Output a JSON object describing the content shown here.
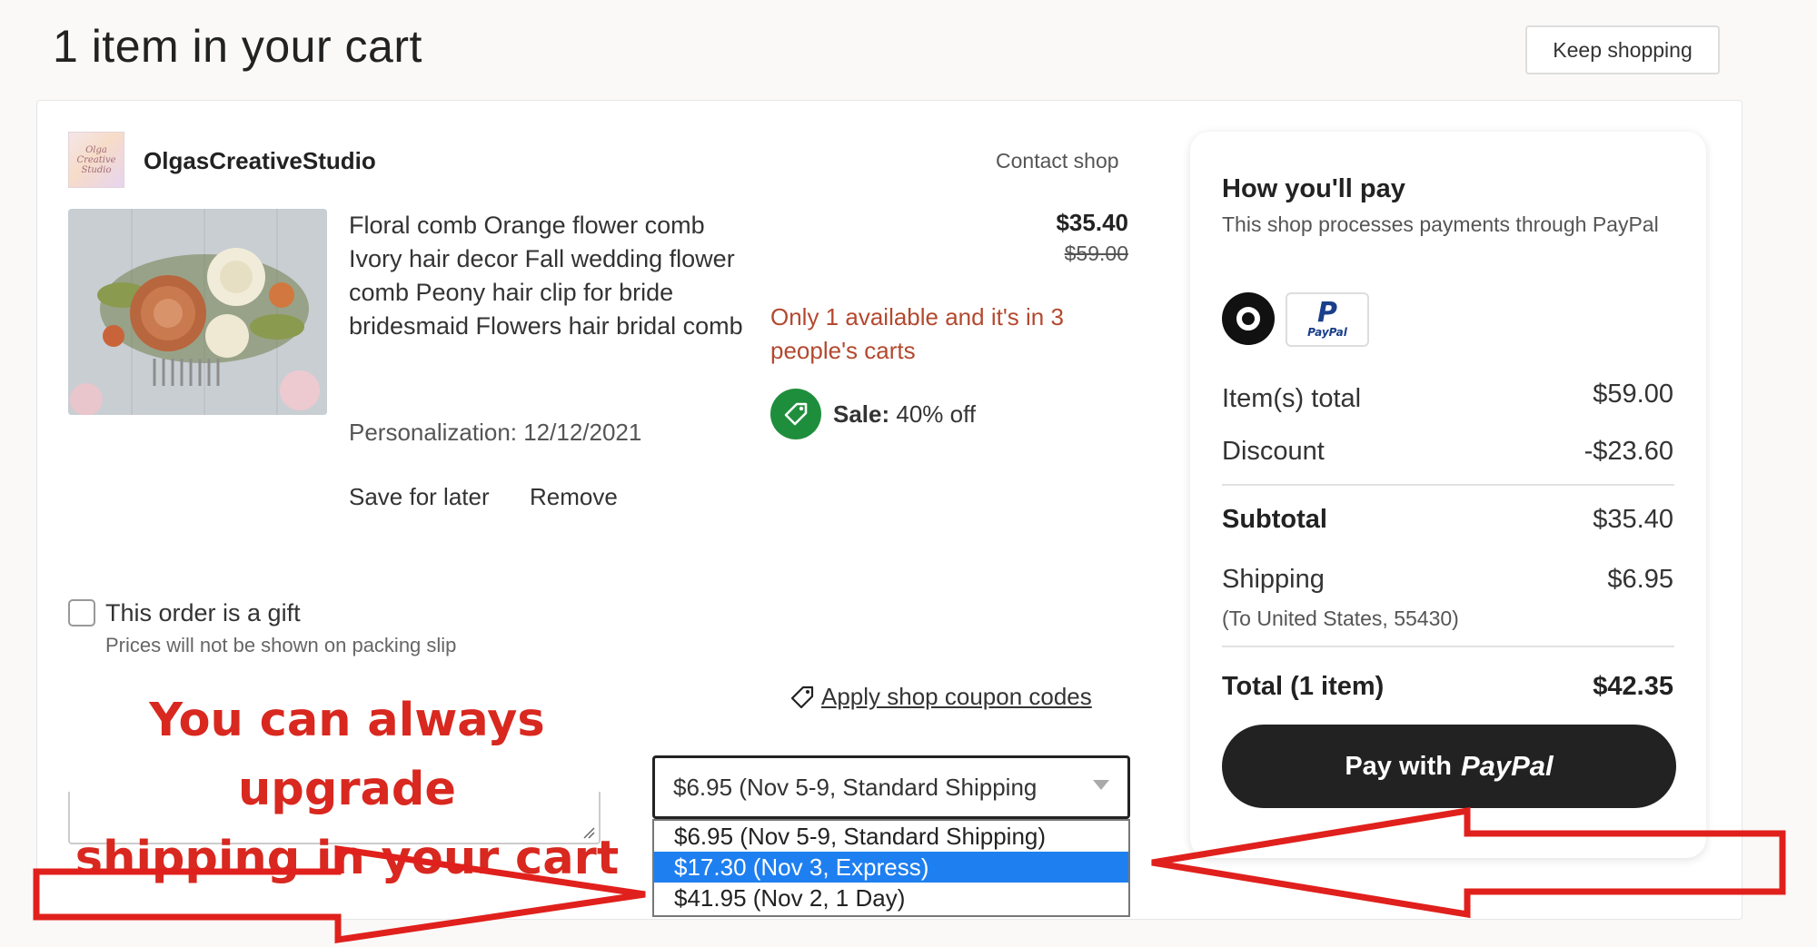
{
  "header": {
    "title": "1 item in your cart",
    "keep_shopping_label": "Keep shopping"
  },
  "shop": {
    "logo_text": "Olga Creative Studio",
    "name": "OlgasCreativeStudio",
    "contact_label": "Contact shop"
  },
  "item": {
    "title": "Floral comb Orange flower comb Ivory hair decor Fall wedding flower comb Peony hair clip for bride bridesmaid Flowers hair bridal comb",
    "price": "$35.40",
    "original_price": "$59.00",
    "scarcity": "Only 1 available and it's in 3 people's carts",
    "sale_label": "Sale:",
    "sale_value": "40% off",
    "personalization": "Personalization: 12/12/2021",
    "save_for_later": "Save for later",
    "remove": "Remove"
  },
  "gift": {
    "label": "This order is a gift",
    "sub": "Prices will not be shown on packing slip",
    "checked": false
  },
  "coupon_link": "Apply shop coupon codes",
  "annotation": {
    "line1": "You can always upgrade",
    "line2": "shipping in your cart",
    "color": "#d8281f"
  },
  "shipping_select": {
    "value": "$6.95 (Nov 5-9, Standard Shipping",
    "options": [
      "$6.95 (Nov 5-9, Standard Shipping)",
      "$17.30 (Nov 3, Express)",
      "$41.95 (Nov 2, 1 Day)"
    ],
    "highlighted_index": 1
  },
  "payment": {
    "heading": "How you'll pay",
    "sub": "This shop processes payments through PayPal",
    "paypal_mark": "P",
    "paypal_word": "PayPal",
    "items_total_label": "Item(s) total",
    "items_total_value": "$59.00",
    "discount_label": "Discount",
    "discount_value": "-$23.60",
    "subtotal_label": "Subtotal",
    "subtotal_value": "$35.40",
    "shipping_label": "Shipping",
    "shipping_value": "$6.95",
    "shipping_dest": "(To United States, 55430)",
    "total_label": "Total (1 item)",
    "total_value": "$42.35",
    "pay_button_prefix": "Pay with",
    "pay_button_brand": "PayPal"
  },
  "colors": {
    "accent_dark": "#222222",
    "sale_green": "#1f8e3c",
    "scarcity_red": "#b3492f",
    "option_highlight": "#1e7ff0",
    "arrow_red": "#e0201c"
  }
}
